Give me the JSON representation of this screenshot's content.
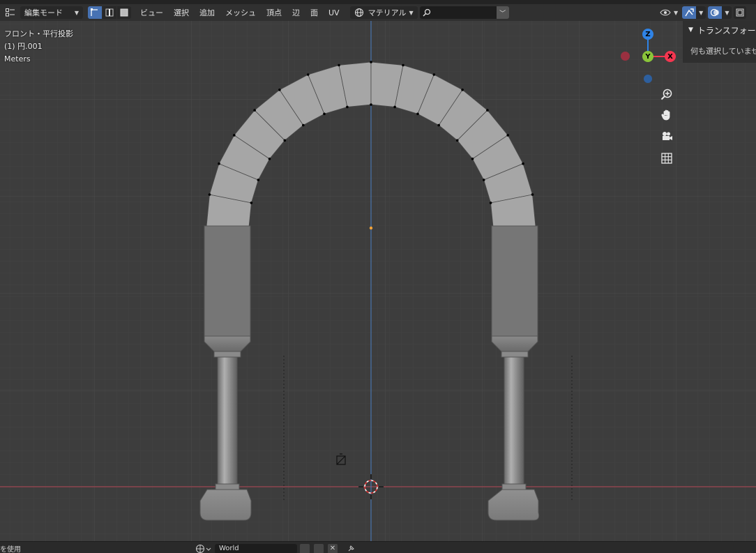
{
  "header": {
    "mode_label": "編集モード",
    "menus": [
      "ビュー",
      "選択",
      "追加",
      "メッシュ",
      "頂点",
      "辺",
      "面",
      "UV"
    ],
    "shading_label": "マテリアル",
    "search_placeholder": ""
  },
  "viewport": {
    "overlay": {
      "view_name": "フロント・平行投影",
      "object_name": "(1) 円.001",
      "units": "Meters"
    },
    "gizmo": {
      "z_label": "Z",
      "y_label": "Y",
      "x_label": "X",
      "colors": {
        "x": "#f53650",
        "y": "#8ac53a",
        "z": "#2f83e6",
        "neg_x": "#9a3040",
        "neg_z": "#2d5f9e"
      }
    },
    "nav_icons": [
      "zoom-icon",
      "hand-pan-icon",
      "camera-icon",
      "grid-icon"
    ]
  },
  "n_panel": {
    "title": "トランスフォーム",
    "message": "何も選択していません"
  },
  "bottom": {
    "left_text": "を使用",
    "world_name": "World"
  },
  "colors": {
    "grid_bg": "#3d3d3d",
    "x_axis": "#c74758",
    "z_axis": "#4a7fc4",
    "header_bg": "#303030",
    "accent": "#4772b3"
  }
}
